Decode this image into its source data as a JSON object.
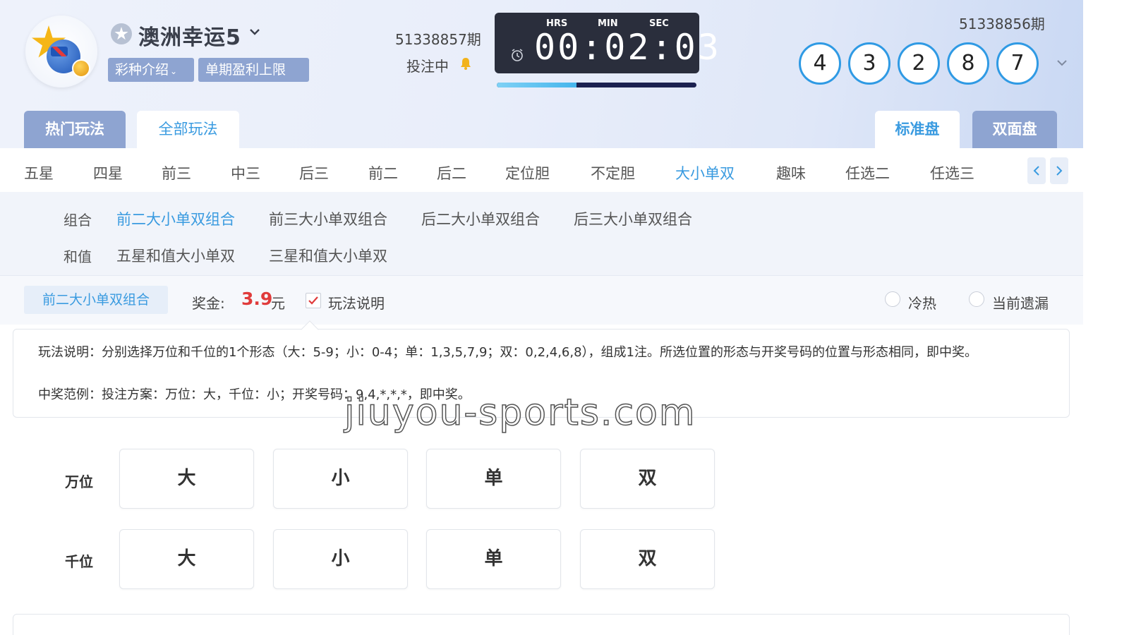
{
  "header": {
    "game_title": "澳洲幸运5",
    "chip_intro": "彩种介绍",
    "chip_limit": "单期盈利上限",
    "current_issue": "51338857期",
    "bet_status": "投注中",
    "timer": {
      "hrs_label": "HRS",
      "min_label": "MIN",
      "sec_label": "SEC",
      "display": "00:02:03",
      "progress": 0.4
    },
    "last_issue": "51338856期",
    "draw_numbers": [
      "4",
      "3",
      "2",
      "8",
      "7"
    ]
  },
  "tabs": {
    "hot": "热门玩法",
    "all": "全部玩法",
    "standard": "标准盘",
    "two_sided": "双面盘"
  },
  "categories": [
    "五星",
    "四星",
    "前三",
    "中三",
    "后三",
    "前二",
    "后二",
    "定位胆",
    "不定胆",
    "大小单双",
    "趣味",
    "任选二",
    "任选三"
  ],
  "active_category": "大小单双",
  "sub_methods": {
    "combo_label": "组合",
    "combo_items": [
      "前二大小单双组合",
      "前三大小单双组合",
      "后二大小单双组合",
      "后三大小单双组合"
    ],
    "sum_label": "和值",
    "sum_items": [
      "五星和值大小单双",
      "三星和值大小单双"
    ]
  },
  "info": {
    "current_method": "前二大小单双组合",
    "prize_label": "奖金:",
    "prize_value": "3.9",
    "prize_unit": "元",
    "show_rules_label": "玩法说明",
    "show_rules_checked": true,
    "hot_cold_label": "冷热",
    "missing_label": "当前遗漏"
  },
  "description": {
    "rule": "玩法说明：分别选择万位和千位的1个形态（大：5-9；小：0-4；单：1,3,5,7,9；双：0,2,4,6,8），组成1注。所选位置的形态与开奖号码的位置与形态相同，即中奖。",
    "example": "中奖范例：投注方案：万位：大，千位：小；开奖号码：9,4,*,*,*，即中奖。"
  },
  "watermark": "jiuyou-sports.com",
  "selector": {
    "rows": [
      {
        "label": "万位",
        "options": [
          "大",
          "小",
          "单",
          "双"
        ]
      },
      {
        "label": "千位",
        "options": [
          "大",
          "小",
          "单",
          "双"
        ]
      }
    ]
  },
  "colors": {
    "accent": "#3a9be0",
    "chip": "#8ea4d1",
    "prize": "#e03b3b",
    "ball_border": "#2f9ae4",
    "timer_bg": "#2a2e3c"
  },
  "icons": {
    "favorite": "star-icon",
    "bell": "bell-icon",
    "clock": "alarm-clock-icon",
    "expand": "chevron-down-icon"
  }
}
